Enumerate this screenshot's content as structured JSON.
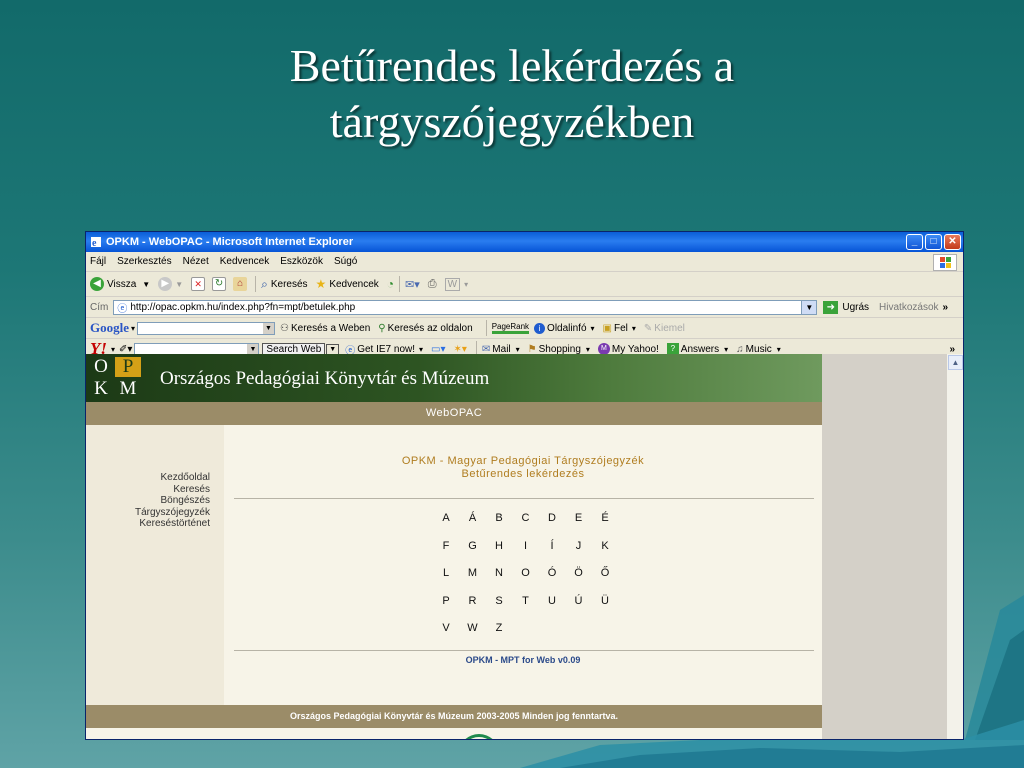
{
  "slide": {
    "title_line1": "Betűrendes lekérdezés a",
    "title_line2": "tárgyszójegyzékben"
  },
  "browser": {
    "window_title": "OPKM - WebOPAC - Microsoft Internet Explorer",
    "menu": [
      "Fájl",
      "Szerkesztés",
      "Nézet",
      "Kedvencek",
      "Eszközök",
      "Súgó"
    ],
    "toolbar": {
      "back": "Vissza",
      "search": "Keresés",
      "favorites": "Kedvencek"
    },
    "address": {
      "label": "Cím",
      "url": "http://opac.opkm.hu/index.php?fn=mpt/betulek.php",
      "go": "Ugrás",
      "links": "Hivatkozások",
      "more": "»"
    },
    "google": {
      "logo": "Google",
      "search_web": "Keresés a Weben",
      "search_site": "Keresés az oldalon",
      "pagerank": "PageRank",
      "info": "Oldalinfó",
      "up": "Fel",
      "highlight": "Kiemel"
    },
    "yahoo": {
      "logo": "Y!",
      "search_web": "Search Web",
      "ie7": "Get IE7 now!",
      "mail": "Mail",
      "shopping": "Shopping",
      "myyahoo": "My Yahoo!",
      "answers": "Answers",
      "music": "Music",
      "more": "»"
    }
  },
  "page": {
    "logo_letters": [
      "O",
      "P",
      "K",
      "M"
    ],
    "banner_title": "Országos Pedagógiai Könyvtár és Múzeum",
    "subbanner": "WebOPAC",
    "nav": [
      "Kezdőoldal",
      "Keresés",
      "Böngészés",
      "Tárgyszójegyzék",
      "Kereséstörténet"
    ],
    "heading_line1": "OPKM - Magyar Pedagógiai Tárgyszójegyzék",
    "heading_line2": "Betűrendes lekérdezés",
    "letter_rows": [
      [
        "A",
        "Á",
        "B",
        "C",
        "D",
        "E",
        "É"
      ],
      [
        "F",
        "G",
        "H",
        "I",
        "Í",
        "J",
        "K"
      ],
      [
        "L",
        "M",
        "N",
        "O",
        "Ó",
        "Ö",
        "Ő"
      ],
      [
        "P",
        "R",
        "S",
        "T",
        "U",
        "Ú",
        "Ü"
      ],
      [
        "V",
        "W",
        "Z"
      ]
    ],
    "version": "OPKM - MPT for Web v0.09",
    "footer": "Országos Pedagógiai Könyvtár és Múzeum 2003-2005 Minden jog fenntartva."
  },
  "colors": {
    "slide_bg": "#1d7776",
    "circle": "#1f8a4c",
    "heading": "#b07d20"
  }
}
